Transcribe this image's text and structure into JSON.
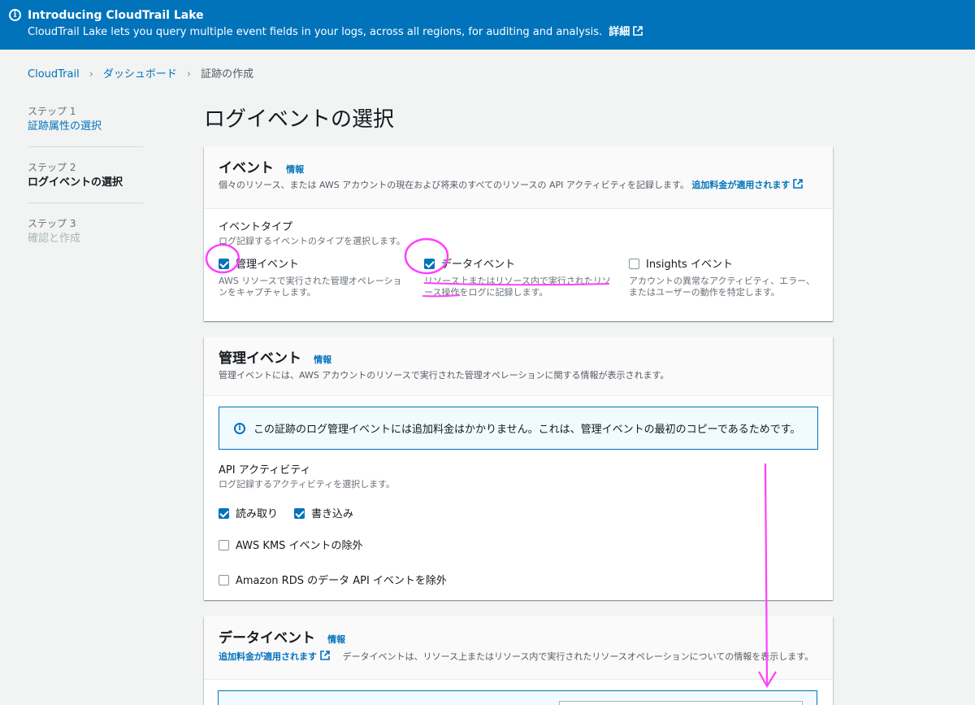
{
  "banner": {
    "title": "Introducing CloudTrail Lake",
    "text": "CloudTrail Lake lets you query multiple event fields in your logs, across all regions, for auditing and analysis.",
    "link": "詳細"
  },
  "breadcrumb": [
    "CloudTrail",
    "ダッシュボード",
    "証跡の作成"
  ],
  "steps": [
    {
      "num": "ステップ 1",
      "label": "証跡属性の選択"
    },
    {
      "num": "ステップ 2",
      "label": "ログイベントの選択"
    },
    {
      "num": "ステップ 3",
      "label": "確認と作成"
    }
  ],
  "page_title": "ログイベントの選択",
  "events_card": {
    "title": "イベント",
    "info": "情報",
    "desc": "個々のリソース、または AWS アカウントの現在および将来のすべてのリソースの API アクティビティを記録します。",
    "desc_link": "追加料金が適用されます",
    "type_label": "イベントタイプ",
    "type_sublabel": "ログ記録するイベントのタイプを選択します。",
    "options": [
      {
        "label": "管理イベント",
        "desc": "AWS リソースで実行された管理オペレーションをキャプチャします。",
        "checked": true
      },
      {
        "label": "データイベント",
        "desc": "リソース上またはリソース内で実行されたリソース操作をログに記録します。",
        "checked": true
      },
      {
        "label": "Insights イベント",
        "desc": "アカウントの異常なアクティビティ、エラー、またはユーザーの動作を特定します。",
        "checked": false
      }
    ]
  },
  "mgmt_card": {
    "title": "管理イベント",
    "info": "情報",
    "desc": "管理イベントには、AWS アカウントのリソースで実行された管理オペレーションに関する情報が表示されます。",
    "alert": "この証跡のログ管理イベントには追加料金はかかりません。これは、管理イベントの最初のコピーであるためです。",
    "api_label": "API アクティビティ",
    "api_sublabel": "ログ記録するアクティビティを選択します。",
    "read": "読み取り",
    "write": "書き込み",
    "kms": "AWS KMS イベントの除外",
    "rds": "Amazon RDS のデータ API イベントを除外"
  },
  "data_card": {
    "title": "データイベント",
    "info": "情報",
    "desc_link": "追加料金が適用されます",
    "desc": "データイベントは、リソース上またはリソース内で実行されたリソースオペレーションについての情報を表示します。"
  },
  "colors": {
    "banner": "#0073bb",
    "link": "#0073bb",
    "annotation": "#ff40ff"
  }
}
